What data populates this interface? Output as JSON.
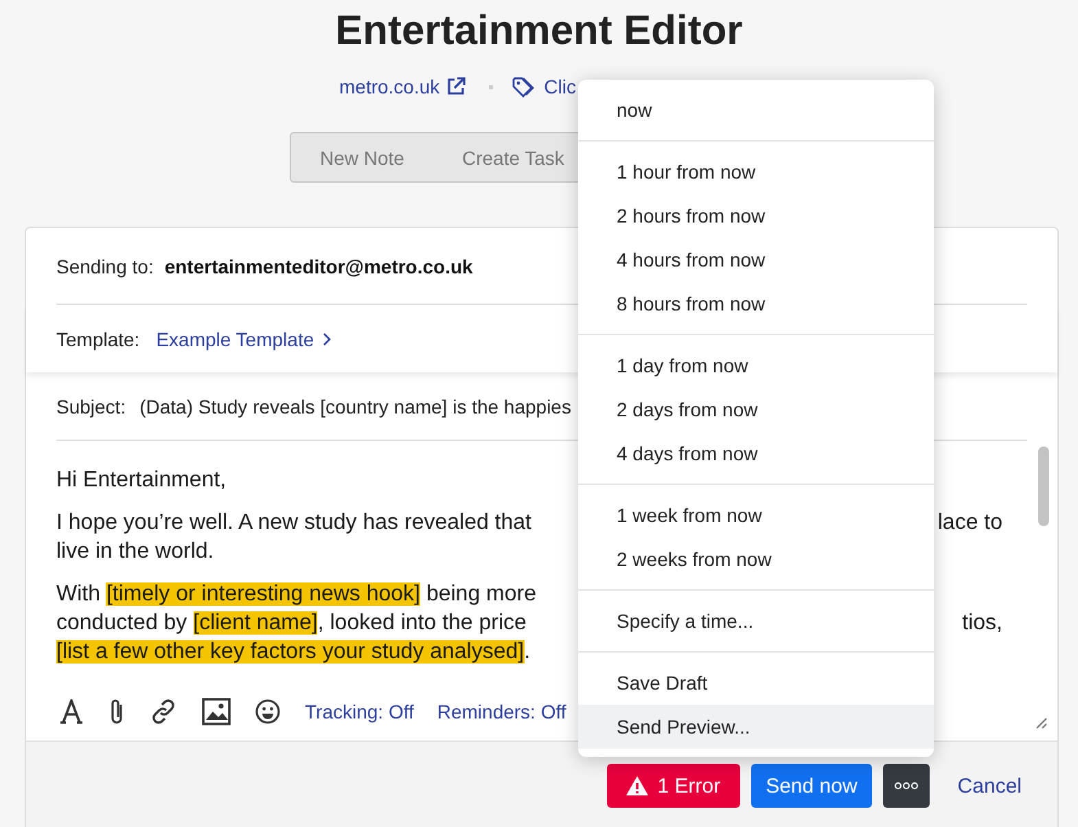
{
  "title": "Entertainment Editor",
  "links": {
    "website": "metro.co.uk",
    "tags": "Clic"
  },
  "tabs": [
    {
      "label": "New Note",
      "selected": false
    },
    {
      "label": "Create Task",
      "selected": false
    }
  ],
  "email": {
    "sending_to_label": "Sending to:",
    "recipient": "entertainmenteditor@metro.co.uk",
    "template_label": "Template:",
    "template": "Example Template",
    "subject_label": "Subject:",
    "subject": "(Data) Study reveals [country name] is the happies",
    "greeting": "Hi Entertainment,",
    "paragraphs": [
      {
        "lines": [
          {
            "segments": [
              {
                "text": "I hope you’re well. A new study has revealed that",
                "highlight": false
              }
            ],
            "right": "lace to"
          },
          {
            "segments": [
              {
                "text": "live in the world.",
                "highlight": false
              }
            ]
          }
        ]
      },
      {
        "lines": [
          {
            "segments": [
              {
                "text": "With ",
                "highlight": false
              },
              {
                "text": "[timely or interesting news hook]",
                "highlight": true
              },
              {
                "text": " being more",
                "highlight": false
              }
            ]
          },
          {
            "segments": [
              {
                "text": "conducted by ",
                "highlight": false
              },
              {
                "text": "[client name]",
                "highlight": true
              },
              {
                "text": ", looked into the price",
                "highlight": false
              }
            ],
            "right": "tios,"
          },
          {
            "segments": [
              {
                "text": "[list a few other key factors your study analysed]",
                "highlight": true
              },
              {
                "text": ".",
                "highlight": false
              }
            ]
          }
        ]
      }
    ]
  },
  "toolbar": {
    "tracking": "Tracking: Off",
    "reminders": "Reminders: Off"
  },
  "footer": {
    "error": "1 Error",
    "send": "Send now",
    "cancel": "Cancel"
  },
  "menu": [
    [
      {
        "label": "now",
        "selected": false
      }
    ],
    [
      {
        "label": "1 hour from now",
        "selected": false
      },
      {
        "label": "2 hours from now",
        "selected": false
      },
      {
        "label": "4 hours from now",
        "selected": false
      },
      {
        "label": "8 hours from now",
        "selected": false
      }
    ],
    [
      {
        "label": "1 day from now",
        "selected": false
      },
      {
        "label": "2 days from now",
        "selected": false
      },
      {
        "label": "4 days from now",
        "selected": false
      }
    ],
    [
      {
        "label": "1 week from now",
        "selected": false
      },
      {
        "label": "2 weeks from now",
        "selected": false
      }
    ],
    [
      {
        "label": "Specify a time...",
        "selected": false
      }
    ],
    [
      {
        "label": "Save Draft",
        "selected": false
      },
      {
        "label": "Send Preview...",
        "selected": true
      }
    ]
  ]
}
